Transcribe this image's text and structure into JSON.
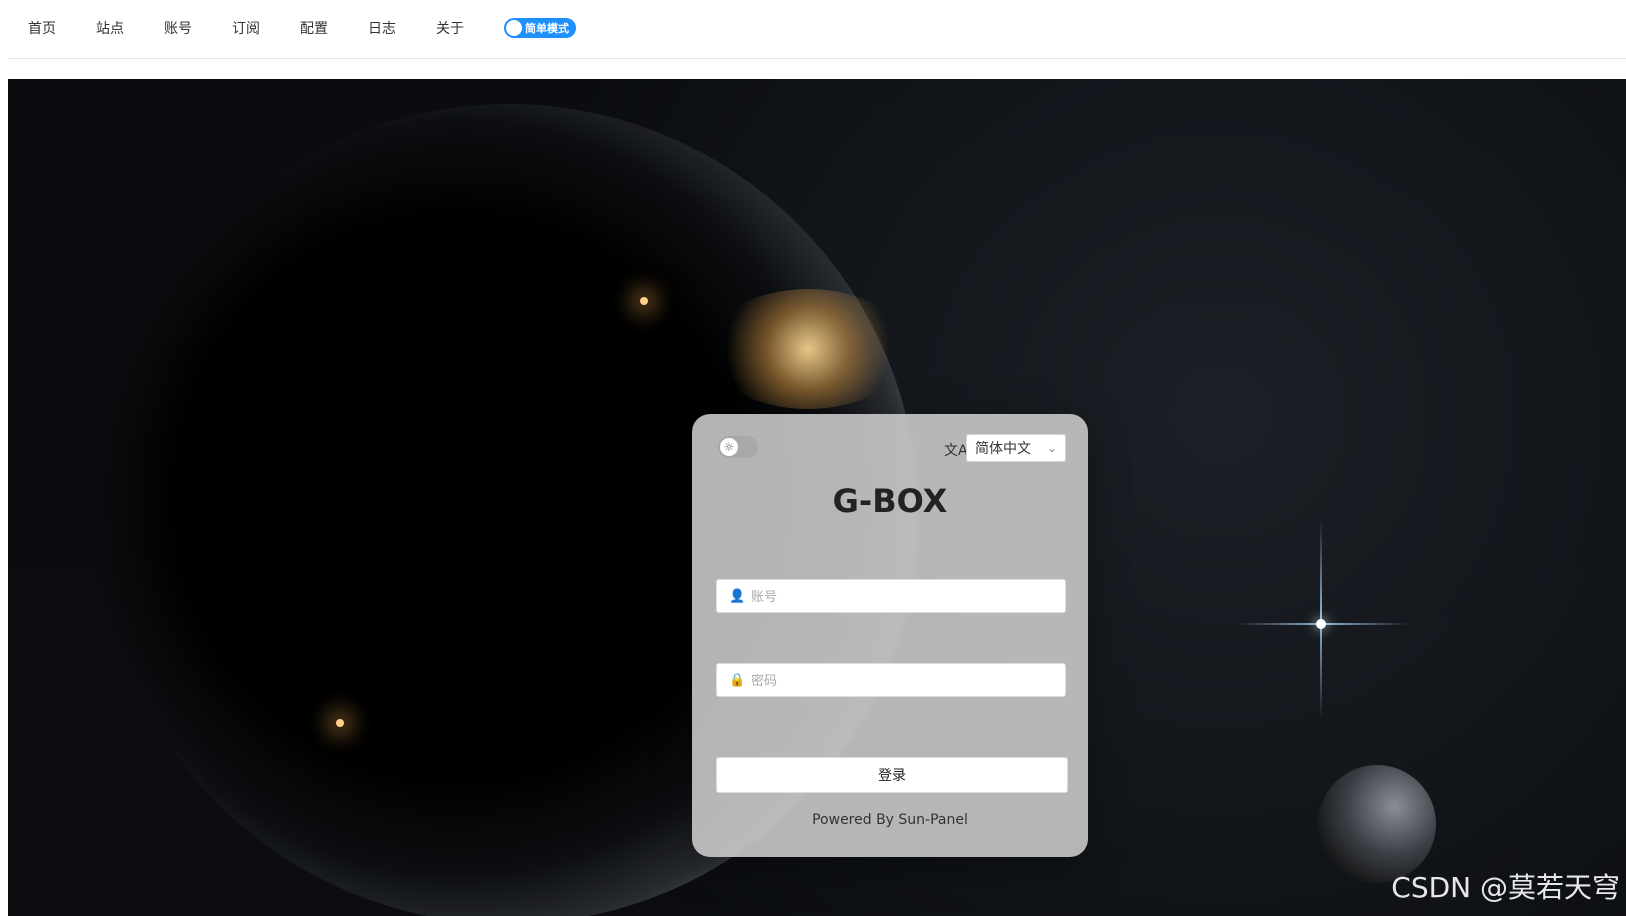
{
  "nav": {
    "items": [
      "首页",
      "站点",
      "账号",
      "订阅",
      "配置",
      "日志",
      "关于"
    ],
    "simple_mode_label": "简单模式"
  },
  "login": {
    "title": "G-BOX",
    "language": "简体中文",
    "username_placeholder": "账号",
    "password_placeholder": "密码",
    "submit_label": "登录",
    "powered_by": "Powered By Sun-Panel"
  },
  "watermark": "CSDN @莫若天穹",
  "colors": {
    "accent": "#1e90ff",
    "card_bg": "#cdcdcd"
  }
}
